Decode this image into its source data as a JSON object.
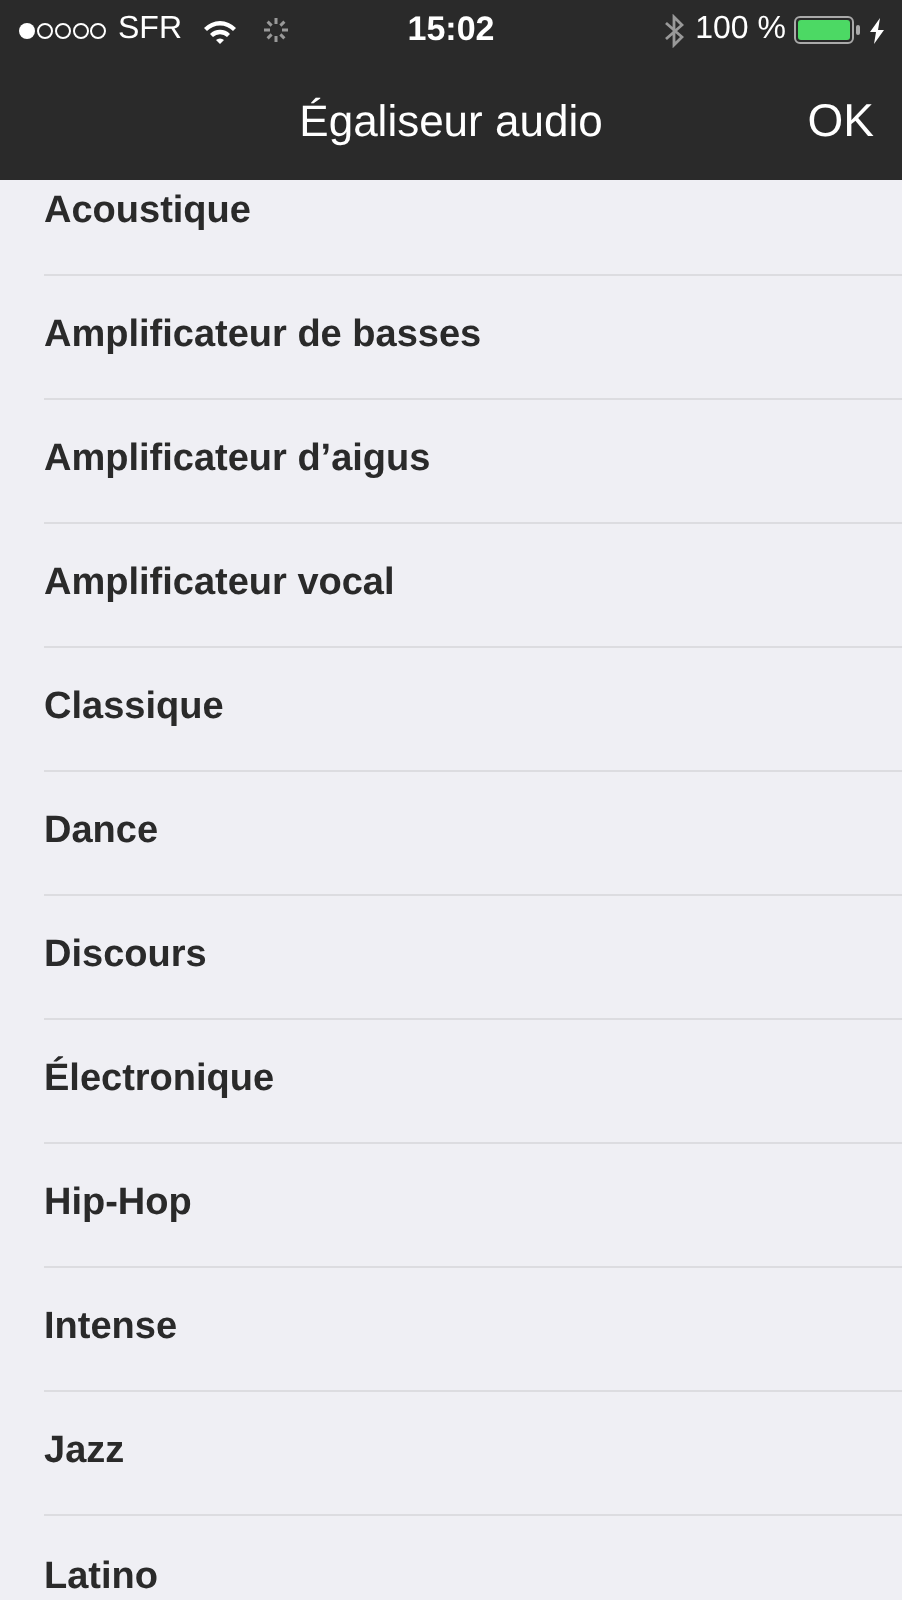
{
  "status_bar": {
    "carrier": "SFR",
    "time": "15:02",
    "battery": "100 %"
  },
  "nav_bar": {
    "title": "Égaliseur audio",
    "done": "OK"
  },
  "presets": [
    {
      "label": "Acoustique"
    },
    {
      "label": "Amplificateur de basses"
    },
    {
      "label": "Amplificateur d’aigus"
    },
    {
      "label": "Amplificateur vocal"
    },
    {
      "label": "Classique"
    },
    {
      "label": "Dance"
    },
    {
      "label": "Discours"
    },
    {
      "label": "Électronique"
    },
    {
      "label": "Hip-Hop"
    },
    {
      "label": "Intense"
    },
    {
      "label": "Jazz"
    },
    {
      "label": "Latino"
    }
  ]
}
